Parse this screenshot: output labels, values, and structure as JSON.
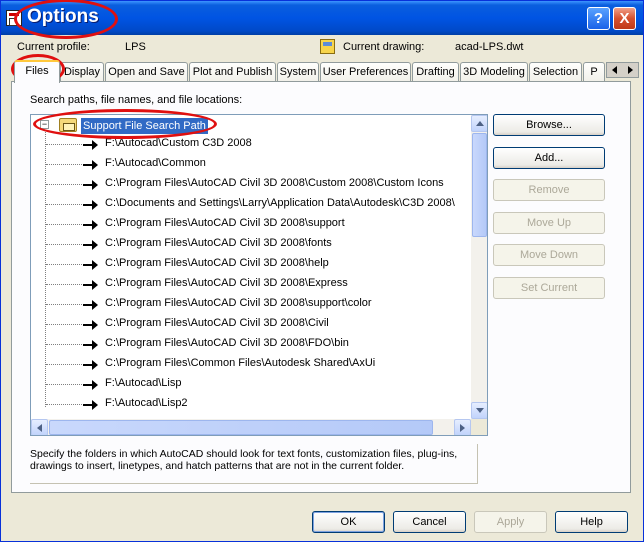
{
  "window": {
    "title": "Options",
    "help_label": "?",
    "close_label": "X"
  },
  "profile": {
    "current_profile_label": "Current profile:",
    "current_profile_value": "LPS",
    "current_drawing_label": "Current drawing:",
    "current_drawing_value": "acad-LPS.dwt"
  },
  "tabs": [
    {
      "label": "Files",
      "active": true
    },
    {
      "label": "Display"
    },
    {
      "label": "Open and Save"
    },
    {
      "label": "Plot and Publish"
    },
    {
      "label": "System"
    },
    {
      "label": "User Preferences"
    },
    {
      "label": "Drafting"
    },
    {
      "label": "3D Modeling"
    },
    {
      "label": "Selection"
    },
    {
      "label": "P"
    }
  ],
  "files": {
    "section_label": "Search paths, file names, and file locations:",
    "root_item": "Support File Search Path",
    "paths": [
      "F:\\Autocad\\Custom C3D 2008",
      "F:\\Autocad\\Common",
      "C:\\Program Files\\AutoCAD Civil 3D 2008\\Custom 2008\\Custom Icons",
      "C:\\Documents and Settings\\Larry\\Application Data\\Autodesk\\C3D 2008\\",
      "C:\\Program Files\\AutoCAD Civil 3D 2008\\support",
      "C:\\Program Files\\AutoCAD Civil 3D 2008\\fonts",
      "C:\\Program Files\\AutoCAD Civil 3D 2008\\help",
      "C:\\Program Files\\AutoCAD Civil 3D 2008\\Express",
      "C:\\Program Files\\AutoCAD Civil 3D 2008\\support\\color",
      "C:\\Program Files\\AutoCAD Civil 3D 2008\\Civil",
      "C:\\Program Files\\AutoCAD Civil 3D 2008\\FDO\\bin",
      "C:\\Program Files\\Common Files\\Autodesk Shared\\AxUi",
      "F:\\Autocad\\Lisp",
      "F:\\Autocad\\Lisp2"
    ],
    "buttons": {
      "browse": "Browse...",
      "add": "Add...",
      "remove": "Remove",
      "move_up": "Move Up",
      "move_down": "Move Down",
      "set_current": "Set Current"
    },
    "description": "Specify the folders in which AutoCAD should look for text fonts, customization files, plug-ins, drawings to insert, linetypes, and hatch patterns that are not in the current folder."
  },
  "dialog_buttons": {
    "ok": "OK",
    "cancel": "Cancel",
    "apply": "Apply",
    "help": "Help"
  },
  "colors": {
    "titlebar": "#0054e3",
    "selection": "#316ac5",
    "annotation": "#e01010"
  }
}
